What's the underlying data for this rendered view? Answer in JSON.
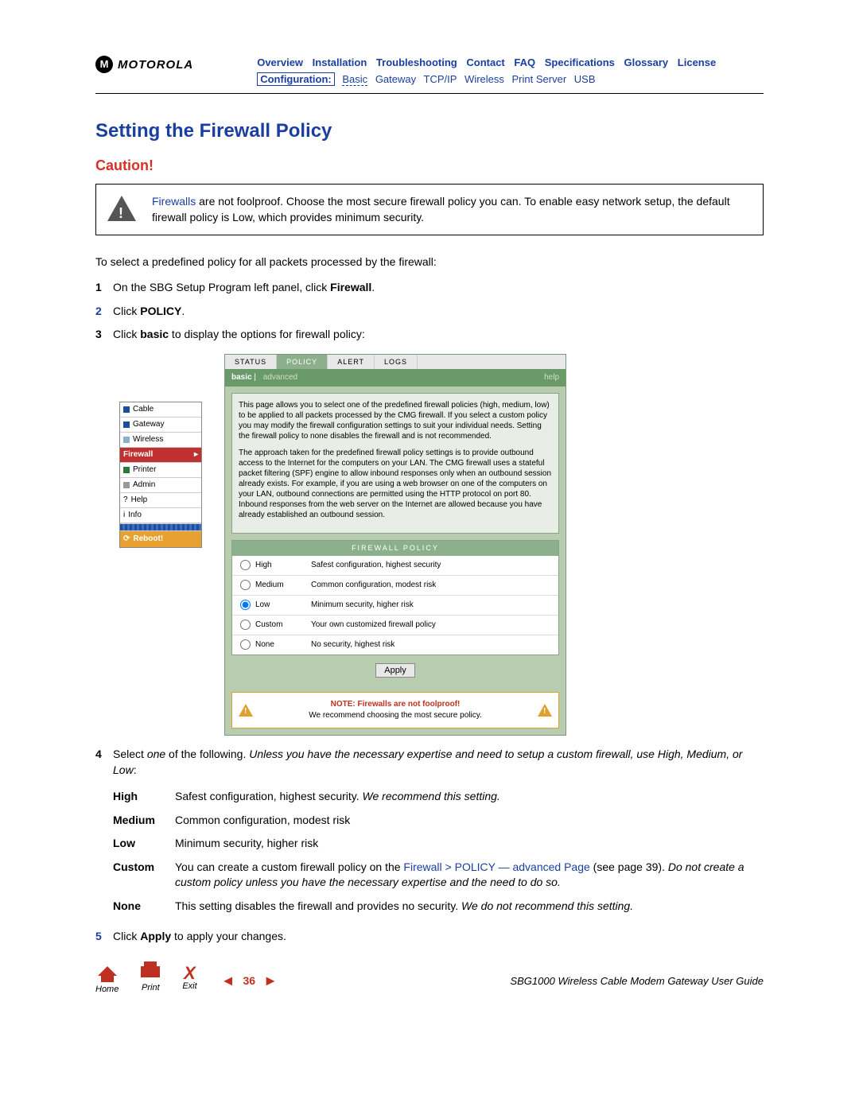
{
  "brand": "MOTOROLA",
  "nav_top": [
    "Overview",
    "Installation",
    "Troubleshooting",
    "Contact",
    "FAQ",
    "Specifications",
    "Glossary",
    "License"
  ],
  "nav_bottom": {
    "label": "Configuration:",
    "items": [
      "Basic",
      "Gateway",
      "TCP/IP",
      "Wireless",
      "Print Server",
      "USB"
    ]
  },
  "page_title": "Setting the Firewall Policy",
  "caution_heading": "Caution!",
  "caution_text": {
    "link": "Firewalls",
    "rest": " are not foolproof. Choose the most secure firewall policy you can. To enable easy network setup, the default firewall policy is Low, which provides minimum security."
  },
  "intro": "To select a predefined policy for all packets processed by the firewall:",
  "steps": {
    "s1": {
      "num": "1",
      "text_pre": "On the SBG Setup Program left panel, click ",
      "bold": "Firewall",
      "text_post": "."
    },
    "s2": {
      "num": "2",
      "text_pre": "Click ",
      "bold": "POLICY",
      "text_post": "."
    },
    "s3": {
      "num": "3",
      "text_pre": "Click ",
      "bold": "basic",
      "text_post": " to display the options for firewall policy:"
    },
    "s4": {
      "num": "4",
      "lead": "Select ",
      "italic1": "one",
      "mid": " of the following. ",
      "italic2": "Unless you have the necessary expertise and need to setup a custom firewall, use High, Medium, or Low",
      "tail": ":"
    },
    "s5": {
      "num": "5",
      "text_pre": "Click ",
      "bold": "Apply",
      "text_post": " to apply your changes."
    }
  },
  "left_panel": [
    "Cable",
    "Gateway",
    "Wireless",
    "Firewall",
    "Printer",
    "Admin",
    "Help",
    "Info"
  ],
  "left_panel_reboot": "Reboot!",
  "screenshot": {
    "tabs": [
      "STATUS",
      "POLICY",
      "ALERT",
      "LOGS"
    ],
    "subtabs": {
      "basic": "basic",
      "advanced": "advanced",
      "help": "help"
    },
    "desc1": "This page allows you to select one of the predefined firewall policies (high, medium, low) to be applied to all packets processed by the CMG firewall. If you select a custom policy you may modify the firewall configuration settings to suit your individual needs. Setting the firewall policy to none disables the firewall and is not recommended.",
    "desc2": "The approach taken for the predefined firewall policy settings is to provide outbound access to the Internet for the computers on your LAN. The CMG firewall uses a stateful packet filtering (SPF) engine to allow inbound responses only when an outbound session already exists. For example, if you are using a web browser on one of the computers on your LAN, outbound connections are permitted using the HTTP protocol on port 80. Inbound responses from the web server on the Internet are allowed because you have already established an outbound session.",
    "policy_header": "FIREWALL POLICY",
    "options": [
      {
        "label": "High",
        "desc": "Safest configuration, highest security"
      },
      {
        "label": "Medium",
        "desc": "Common configuration, modest risk"
      },
      {
        "label": "Low",
        "desc": "Minimum security, higher risk"
      },
      {
        "label": "Custom",
        "desc": "Your own customized firewall policy"
      },
      {
        "label": "None",
        "desc": "No security, highest risk"
      }
    ],
    "apply": "Apply",
    "note_red": "NOTE: Firewalls are not foolproof!",
    "note_sub": "We recommend choosing the most secure policy."
  },
  "definitions": [
    {
      "term": "High",
      "desc_pre": "Safest configuration, highest security. ",
      "italic": "We recommend this setting.",
      "desc_post": ""
    },
    {
      "term": "Medium",
      "desc_pre": "Common configuration, modest risk",
      "italic": "",
      "desc_post": ""
    },
    {
      "term": "Low",
      "desc_pre": "Minimum security, higher risk",
      "italic": "",
      "desc_post": ""
    },
    {
      "term": "Custom",
      "desc_pre": "You can create a custom firewall policy on the ",
      "link": "Firewall > POLICY — advanced Page",
      "desc_mid": " (see page 39). ",
      "italic": "Do not create a custom policy unless you have the necessary expertise and the need to do so.",
      "desc_post": ""
    },
    {
      "term": "None",
      "desc_pre": "This setting disables the firewall and provides no security. ",
      "italic": "We do not recommend this setting.",
      "desc_post": ""
    }
  ],
  "footer": {
    "home": "Home",
    "print": "Print",
    "exit": "Exit",
    "prev": "◄",
    "page": "36",
    "next": "►",
    "guide": "SBG1000 Wireless Cable Modem Gateway User Guide"
  }
}
